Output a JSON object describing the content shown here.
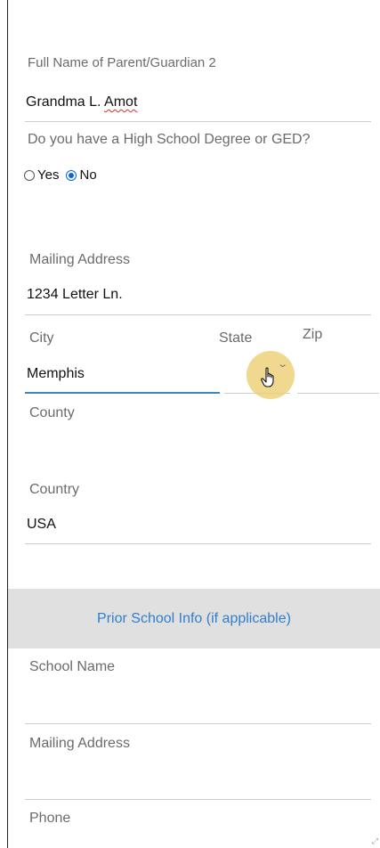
{
  "guardian2": {
    "label": "Full Name of Parent/Guardian 2",
    "value": "Grandma L. Amot",
    "value_first": "Grandma L. ",
    "value_misspelled": "Amot"
  },
  "ged": {
    "question": "Do you have a High School Degree or GED?",
    "options": [
      {
        "label": "Yes",
        "checked": false
      },
      {
        "label": "No",
        "checked": true
      }
    ]
  },
  "mailing": {
    "label": "Mailing Address",
    "value": "1234 Letter Ln."
  },
  "city": {
    "label": "City",
    "value": "Memphis"
  },
  "state": {
    "label": "State",
    "value": ""
  },
  "zip": {
    "label": "Zip",
    "value": ""
  },
  "county": {
    "label": "County",
    "value": ""
  },
  "country": {
    "label": "Country",
    "value": "USA"
  },
  "prior_school": {
    "heading": "Prior School Info (if applicable)",
    "school_name_label": "School Name",
    "mailing_label": "Mailing Address",
    "phone_label": "Phone"
  },
  "colors": {
    "accent": "#2f7fce",
    "radio_checked": "#0a66d9",
    "section_band": "#e0e0e0",
    "label_gray": "#6b6b6b",
    "cursor_halo": "#ecce6e"
  },
  "icons": {
    "state_dropdown": "chevron-down-icon",
    "cursor": "hand-pointer-icon"
  }
}
